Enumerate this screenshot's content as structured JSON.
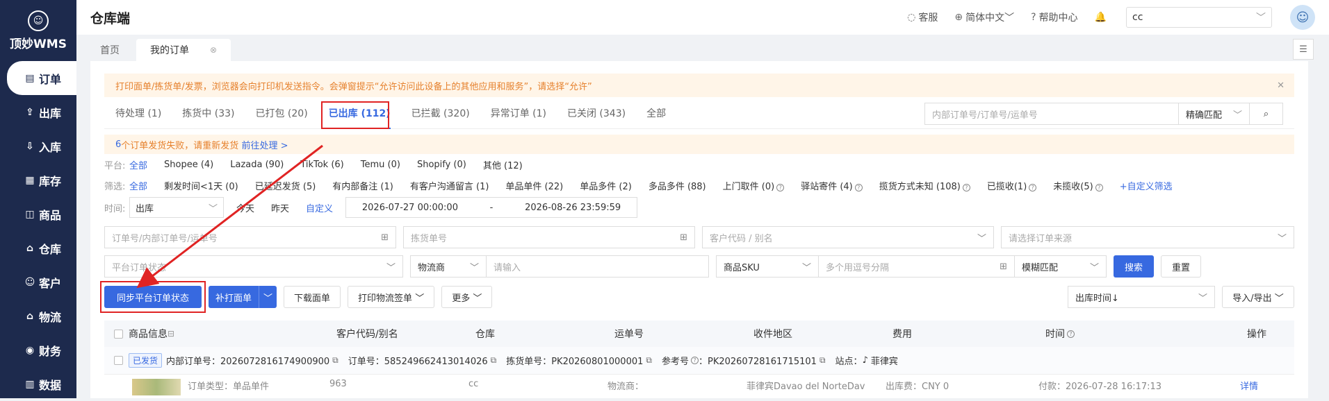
{
  "sidebar": {
    "logo_text": "顶妙WMS",
    "items": [
      {
        "label": "订单",
        "icon": "order-icon"
      },
      {
        "label": "出库",
        "icon": "outbound-icon"
      },
      {
        "label": "入库",
        "icon": "inbound-icon"
      },
      {
        "label": "库存",
        "icon": "inventory-icon"
      },
      {
        "label": "商品",
        "icon": "product-icon"
      },
      {
        "label": "仓库",
        "icon": "warehouse-icon"
      },
      {
        "label": "客户",
        "icon": "customer-icon"
      },
      {
        "label": "物流",
        "icon": "logistics-icon"
      },
      {
        "label": "财务",
        "icon": "finance-icon"
      },
      {
        "label": "数据",
        "icon": "data-icon"
      }
    ]
  },
  "header": {
    "title": "仓库端",
    "service": "客服",
    "language": "简体中文",
    "help": "帮助中心",
    "user_value": "cc"
  },
  "page_tabs": [
    {
      "label": "首页"
    },
    {
      "label": "我的订单"
    }
  ],
  "notice": "打印面单/拣货单/发票，浏览器会向打印机发送指令。会弹窗提示“允许访问此设备上的其他应用和服务”，请选择“允许”",
  "status_tabs": [
    {
      "label": "待处理 (1)"
    },
    {
      "label": "拣货中 (33)"
    },
    {
      "label": "已打包 (20)"
    },
    {
      "label": "已出库 (112)"
    },
    {
      "label": "已拦截 (320)"
    },
    {
      "label": "异常订单 (1)"
    },
    {
      "label": "已关闭 (343)"
    },
    {
      "label": "全部"
    }
  ],
  "top_search": {
    "placeholder": "内部订单号/订单号/运单号",
    "mode": "精确匹配"
  },
  "warn": {
    "count": "6",
    "text": "个订单发货失败，请重新发货",
    "link": "前往处理 >"
  },
  "platform": {
    "label": "平台:",
    "items": [
      "全部",
      "Shopee (4)",
      "Lazada (90)",
      "TikTok (6)",
      "Temu (0)",
      "Shopify (0)",
      "其他 (12)"
    ]
  },
  "filter": {
    "label": "筛选:",
    "items": [
      "全部",
      "剩发时间<1天 (0)",
      "已延迟发货 (5)",
      "有内部备注 (1)",
      "有客户沟通留言 (1)",
      "单品单件 (22)",
      "单品多件 (2)",
      "多品多件 (88)",
      "上门取件 (0)",
      "驿站寄件 (4)",
      "揽货方式未知 (108)",
      "已揽收(1)",
      "未揽收(5)"
    ],
    "custom": "+自定义筛选"
  },
  "time": {
    "label": "时间:",
    "select": "出库",
    "today": "今天",
    "yesterday": "昨天",
    "custom": "自定义",
    "start": "2026-07-27 00:00:00",
    "sep": "-",
    "end": "2026-08-26 23:59:59"
  },
  "form": {
    "order_no": "订单号/内部订单号/运单号",
    "pick_no": "拣货单号",
    "customer": "客户代码 / 别名",
    "source": "请选择订单来源",
    "platform_status": "平台订单状态",
    "carrier": "物流商",
    "carrier_input": "请输入",
    "sku_select": "商品SKU",
    "sku_input": "多个用逗号分隔",
    "match": "模糊匹配",
    "search": "搜索",
    "reset": "重置"
  },
  "actions": {
    "sync": "同步平台订单状态",
    "reprint": "补打面单",
    "download": "下载面单",
    "print_label": "打印物流签单",
    "more": "更多",
    "sort": "出库时间↓",
    "import_export": "导入/导出"
  },
  "table": {
    "columns": [
      "商品信息",
      "客户代码/别名",
      "仓库",
      "运单号",
      "收件地区",
      "费用",
      "时间",
      "操作"
    ]
  },
  "order": {
    "status": "已发货",
    "internal": "内部订单号：2026072816174900900",
    "order_no": "订单号：585249662413014026",
    "pick": "拣货单号：PK20260801000001",
    "ref": "参考号",
    "ref_val": "：PK20260728161715101",
    "site": "站点：",
    "country": "菲律宾"
  },
  "row": {
    "type": "订单类型：单品单件",
    "cust": "963",
    "wh": "cc",
    "carrier": "物流商：",
    "area": "菲律宾Davao del NorteDav",
    "fee": "出库费：CNY 0",
    "time": "付款：2026-07-28 16:17:13",
    "op": "详情"
  }
}
